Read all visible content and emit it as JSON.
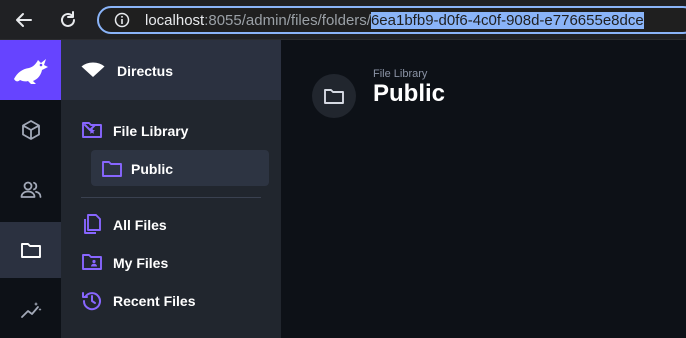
{
  "browser": {
    "url_host": "localhost",
    "url_port_path": ":8055/admin/files/folders/",
    "url_selected": "6ea1bfb9-d0f6-4c0f-908d-e776655e8dce"
  },
  "modules": [
    {
      "name": "content",
      "icon": "box-icon"
    },
    {
      "name": "users",
      "icon": "people-icon"
    },
    {
      "name": "files",
      "icon": "folder-icon",
      "active": true
    },
    {
      "name": "insights",
      "icon": "insights-icon"
    }
  ],
  "project": {
    "name": "Directus"
  },
  "nav": {
    "file_library": "File Library",
    "public": "Public",
    "all_files": "All Files",
    "my_files": "My Files",
    "recent_files": "Recent Files"
  },
  "header": {
    "breadcrumb": "File Library",
    "title": "Public"
  },
  "colors": {
    "accent": "#6644ff",
    "nav_icon": "#8866ff",
    "background": "#0d1117"
  }
}
